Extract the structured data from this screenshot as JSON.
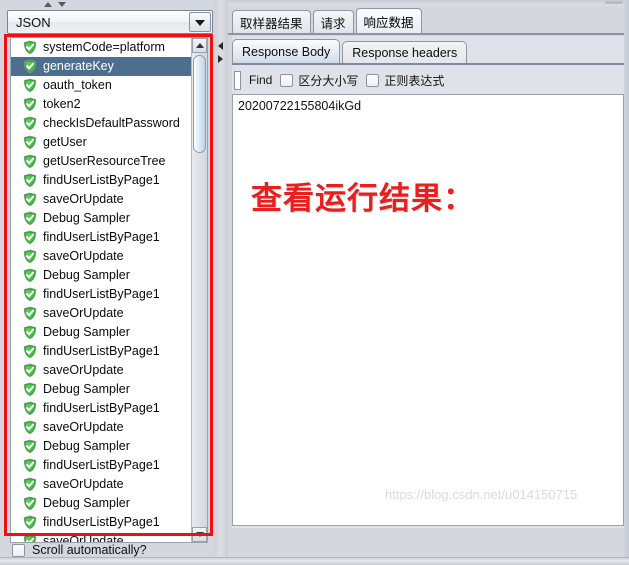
{
  "left_panel": {
    "spinner": {
      "up_icon": "triangle-up-icon",
      "down_icon": "triangle-down-icon"
    },
    "combo": {
      "value": "JSON",
      "arrow_icon": "chevron-down-icon"
    },
    "list": {
      "item_icon": "green-shield-check-icon",
      "selected_index": 1,
      "items": [
        "systemCode=platform",
        "generateKey",
        "oauth_token",
        "token2",
        "checkIsDefaultPassword",
        "getUser",
        "getUserResourceTree",
        "findUserListByPage1",
        "saveOrUpdate",
        "Debug Sampler",
        "findUserListByPage1",
        "saveOrUpdate",
        "Debug Sampler",
        "findUserListByPage1",
        "saveOrUpdate",
        "Debug Sampler",
        "findUserListByPage1",
        "saveOrUpdate",
        "Debug Sampler",
        "findUserListByPage1",
        "saveOrUpdate",
        "Debug Sampler",
        "findUserListByPage1",
        "saveOrUpdate",
        "Debug Sampler",
        "findUserListByPage1",
        "saveOrUpdate"
      ]
    },
    "scrollbar": {
      "up_icon": "scroll-up-arrow-icon",
      "down_icon": "scroll-down-arrow-icon"
    },
    "scroll_automatically": {
      "label": "Scroll automatically?",
      "checked": false
    },
    "highlight_box_color": "#f20f0f"
  },
  "divider": {
    "collapse_left_icon": "triangle-right-icon",
    "collapse_right_icon": "triangle-left-icon"
  },
  "right_panel": {
    "outer_tabs": [
      {
        "label": "取样器结果",
        "active": false
      },
      {
        "label": "请求",
        "active": false
      },
      {
        "label": "响应数据",
        "active": true
      }
    ],
    "inner_tabs": [
      {
        "label": "Response Body",
        "active": true
      },
      {
        "label": "Response headers",
        "active": false
      }
    ],
    "find_bar": {
      "input_value": "",
      "input_placeholder": "",
      "find_label": "Find",
      "options": [
        {
          "label": "区分大小写",
          "checked": false
        },
        {
          "label": "正则表达式",
          "checked": false
        }
      ]
    },
    "response_body": {
      "text": "20200722155804ikGd",
      "annotation": "查看运行结果：",
      "annotation_color": "#e81f1f",
      "watermark": "https://blog.csdn.net/u014150715"
    }
  }
}
